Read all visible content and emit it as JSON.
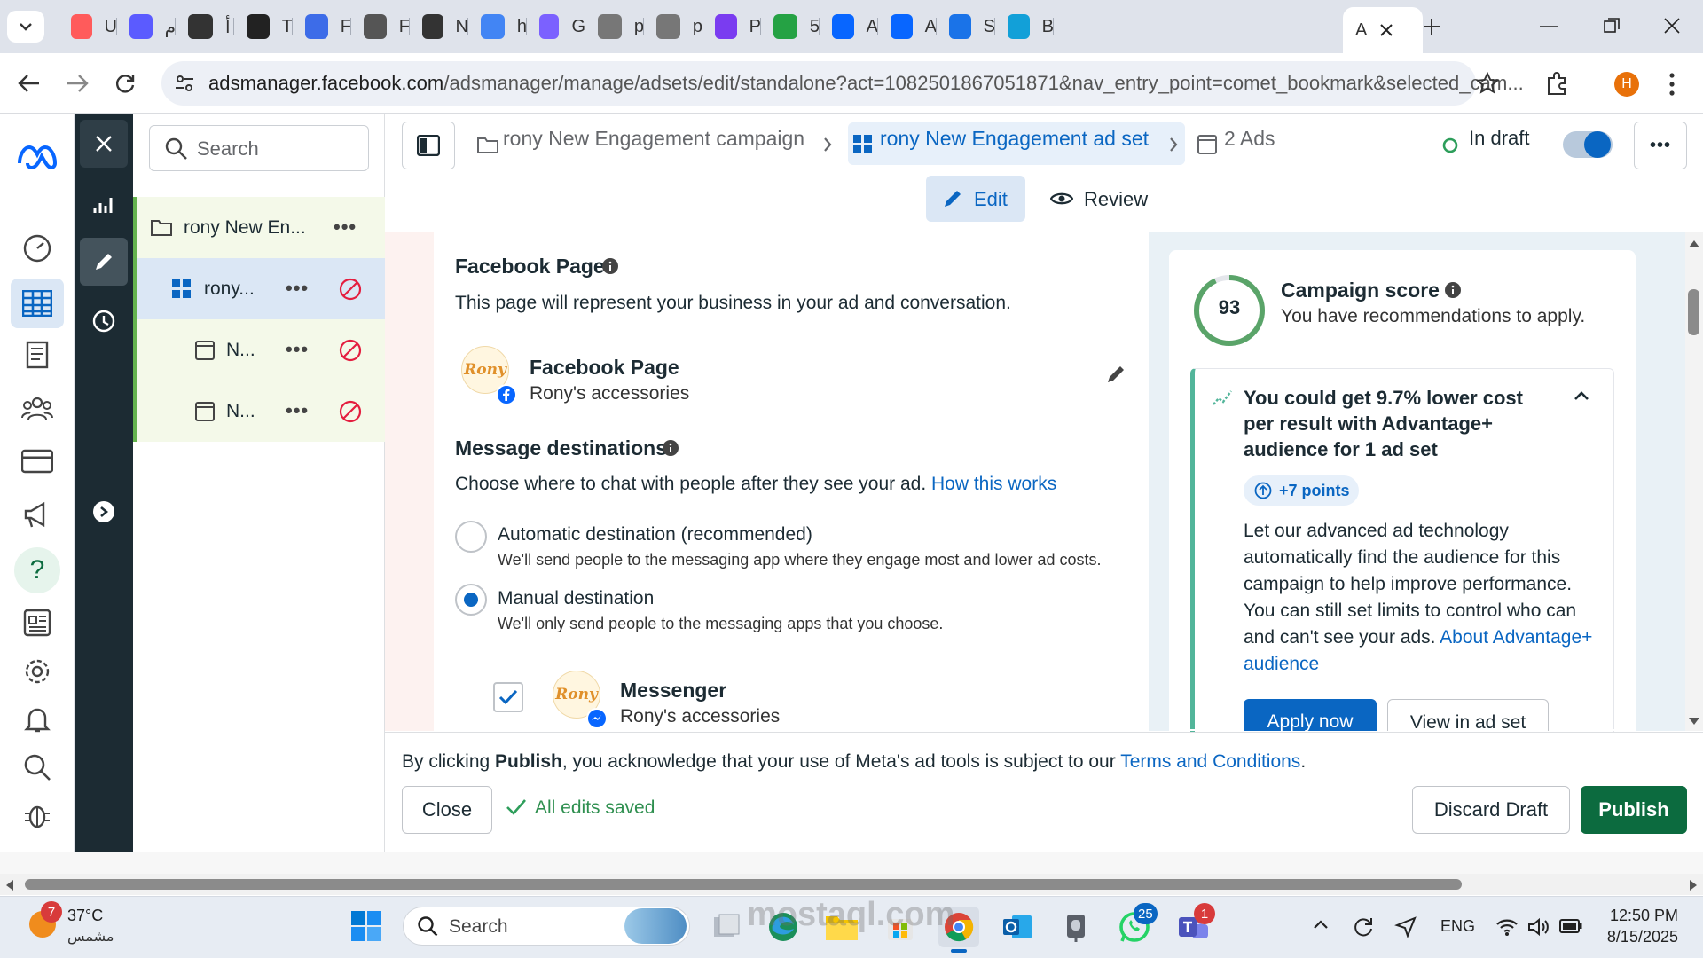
{
  "browser": {
    "tabs": [
      {
        "letter": "U",
        "color": "#ff5b5b"
      },
      {
        "letter": "م",
        "color": "#5b5bff"
      },
      {
        "letter": "أ",
        "color": "#333333"
      },
      {
        "letter": "T",
        "color": "#222222"
      },
      {
        "letter": "F",
        "color": "#3d6ce8"
      },
      {
        "letter": "F",
        "color": "#555555"
      },
      {
        "letter": "N",
        "color": "#333333"
      },
      {
        "letter": "h",
        "color": "#4285f4"
      },
      {
        "letter": "G",
        "color": "#7b61ff"
      },
      {
        "letter": "p",
        "color": "#777777"
      },
      {
        "letter": "p",
        "color": "#777777"
      },
      {
        "letter": "P",
        "color": "#7a3cf0"
      },
      {
        "letter": "5",
        "color": "#25a244"
      },
      {
        "letter": "A",
        "color": "#0866ff"
      },
      {
        "letter": "A",
        "color": "#0866ff"
      },
      {
        "letter": "S",
        "color": "#1a73e8"
      },
      {
        "letter": "B",
        "color": "#12a0d8"
      }
    ],
    "active_tab": {
      "letter": "A"
    },
    "url_host": "adsmanager.facebook.com",
    "url_path": "/adsmanager/manage/adsets/edit/standalone?act=1082501867051871&nav_entry_point=comet_bookmark&selected_cam...",
    "profile_initial": "H"
  },
  "sidebar": {
    "search_placeholder": "Search",
    "tree": [
      {
        "label": "rony New En...",
        "level": 0
      },
      {
        "label": "rony...",
        "level": 1
      },
      {
        "label": "N...",
        "level": 2
      },
      {
        "label": "N...",
        "level": 2
      }
    ]
  },
  "header": {
    "crumb_campaign": "rony New Engagement campaign",
    "crumb_adset": "rony New Engagement ad set",
    "crumb_ads": "2 Ads",
    "status": "In draft",
    "tab_edit": "Edit",
    "tab_review": "Review"
  },
  "form": {
    "fb_page_heading": "Facebook Page",
    "fb_page_desc": "This page will represent your business in your ad and conversation.",
    "page_title": "Facebook Page",
    "page_name": "Rony's accessories",
    "logo_text": "Rony",
    "msg_heading": "Message destinations",
    "msg_desc": "Choose where to chat with people after they see your ad.",
    "msg_link": "How this works",
    "options": [
      {
        "label": "Automatic destination (recommended)",
        "desc": "We'll send people to the messaging app where they engage most and lower ad costs.",
        "selected": false
      },
      {
        "label": "Manual destination",
        "desc": "We'll only send people to the messaging apps that you choose.",
        "selected": true
      }
    ],
    "messenger_title": "Messenger",
    "messenger_name": "Rony's accessories",
    "messenger_checked": true
  },
  "score": {
    "value": "93",
    "title": "Campaign score",
    "subtitle": "You have recommendations to apply.",
    "reco_title": "You could get 9.7% lower cost per result with Advantage+ audience for 1 ad set",
    "points": "+7 points",
    "reco_body": "Let our advanced ad technology automatically find the audience for this campaign to help improve performance. You can still set limits to control who can and can't see your ads.",
    "reco_link": "About Advantage+ audience",
    "apply_btn": "Apply now",
    "view_btn": "View in ad set"
  },
  "footer": {
    "notice_pre": "By clicking ",
    "notice_bold": "Publish",
    "notice_mid": ", you acknowledge that your use of Meta's ad tools is subject to our ",
    "notice_link": "Terms and Conditions",
    "notice_end": ".",
    "close_btn": "Close",
    "saved": "All edits saved",
    "discard_btn": "Discard Draft",
    "publish_btn": "Publish"
  },
  "taskbar": {
    "weather_temp": "37°C",
    "weather_label": "مشمس",
    "weather_badge": "7",
    "search": "Search",
    "whatsapp_badge": "25",
    "teams_badge": "1",
    "lang": "ENG",
    "time": "12:50 PM",
    "date": "8/15/2025",
    "watermark": "mostaql.com"
  },
  "colors": {
    "accent": "#0a66c2",
    "publish": "#0c6b3f",
    "dark_rail": "#1c2b33",
    "score_ring": "#5aa469"
  }
}
